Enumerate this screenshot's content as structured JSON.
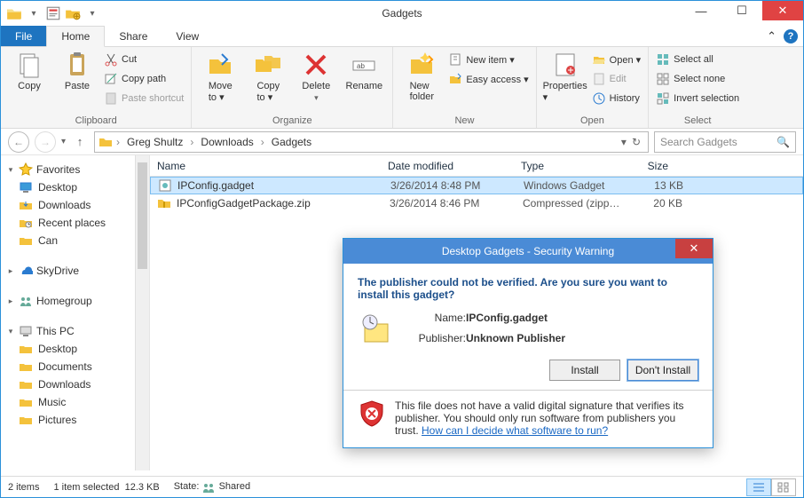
{
  "window_title": "Gadgets",
  "tabs": {
    "file": "File",
    "home": "Home",
    "share": "Share",
    "view": "View"
  },
  "ribbon": {
    "clipboard": {
      "label": "Clipboard",
      "copy": "Copy",
      "paste": "Paste",
      "cut": "Cut",
      "copy_path": "Copy path",
      "paste_shortcut": "Paste shortcut"
    },
    "organize": {
      "label": "Organize",
      "move_to": "Move\nto ▾",
      "copy_to": "Copy\nto ▾",
      "delete": "Delete",
      "rename": "Rename"
    },
    "new": {
      "label": "New",
      "new_folder": "New\nfolder",
      "new_item": "New item ▾",
      "easy_access": "Easy access ▾"
    },
    "open": {
      "label": "Open",
      "properties": "Properties\n▾",
      "open": "Open ▾",
      "edit": "Edit",
      "history": "History"
    },
    "select": {
      "label": "Select",
      "select_all": "Select all",
      "select_none": "Select none",
      "invert": "Invert selection"
    }
  },
  "breadcrumb": {
    "seg1": "Greg Shultz",
    "seg2": "Downloads",
    "seg3": "Gadgets"
  },
  "search_placeholder": "Search Gadgets",
  "nav": {
    "favorites": "Favorites",
    "desktop": "Desktop",
    "downloads": "Downloads",
    "recent": "Recent places",
    "can": "Can",
    "skydrive": "SkyDrive",
    "homegroup": "Homegroup",
    "thispc": "This PC",
    "pc_desktop": "Desktop",
    "pc_documents": "Documents",
    "pc_downloads": "Downloads",
    "pc_music": "Music",
    "pc_pictures": "Pictures"
  },
  "cols": {
    "name": "Name",
    "date": "Date modified",
    "type": "Type",
    "size": "Size"
  },
  "files": [
    {
      "name": "IPConfig.gadget",
      "date": "3/26/2014 8:48 PM",
      "type": "Windows Gadget",
      "size": "13 KB",
      "selected": true
    },
    {
      "name": "IPConfigGadgetPackage.zip",
      "date": "3/26/2014 8:46 PM",
      "type": "Compressed (zipp…",
      "size": "20 KB",
      "selected": false
    }
  ],
  "status": {
    "count": "2 items",
    "selection": "1 item selected",
    "selsize": "12.3 KB",
    "state_label": "State:",
    "state_value": "Shared"
  },
  "dialog": {
    "title": "Desktop Gadgets - Security Warning",
    "headline": "The publisher could not be verified. Are you sure you want to install this gadget?",
    "name_label": "Name:",
    "name_value": "IPConfig.gadget",
    "pub_label": "Publisher:",
    "pub_value": "Unknown Publisher",
    "install": "Install",
    "dont_install": "Don't Install",
    "warn_text": "This file does not have a valid digital signature that verifies its publisher. You should only run software from publishers you trust. ",
    "warn_link": "How can I decide what software to run?"
  }
}
